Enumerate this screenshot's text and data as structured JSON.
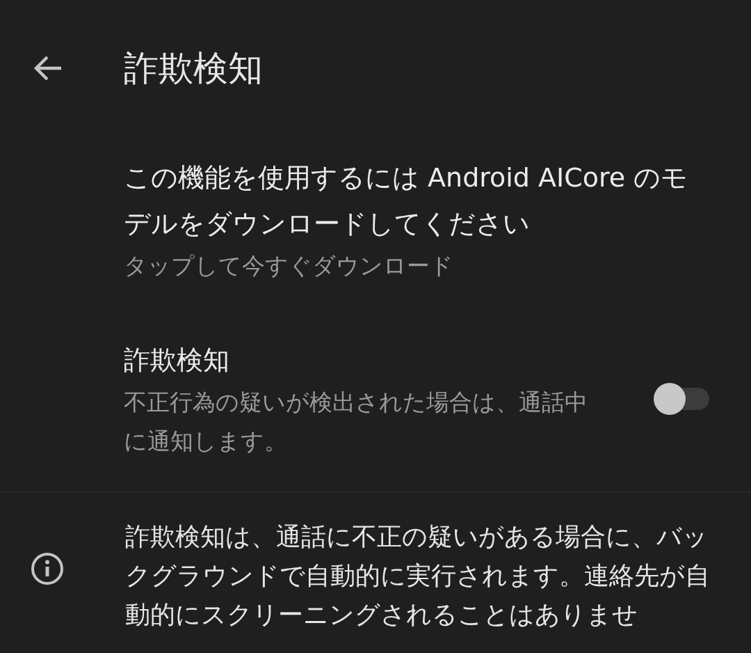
{
  "header": {
    "title": "詐欺検知"
  },
  "items": [
    {
      "kind": "action",
      "title": "この機能を使用するには Android AICore のモデルをダウンロードしてください",
      "summary": "タップして今すぐダウンロード"
    },
    {
      "kind": "toggle",
      "title": "詐欺検知",
      "summary": "不正行為の疑いが検出された場合は、通話中に通知します。",
      "on": false
    }
  ],
  "footer": {
    "text": "詐欺検知は、通話に不正の疑いがある場合に、バックグラウンドで自動的に実行されます。連絡先が自動的にスクリーニングされることはありませ"
  }
}
